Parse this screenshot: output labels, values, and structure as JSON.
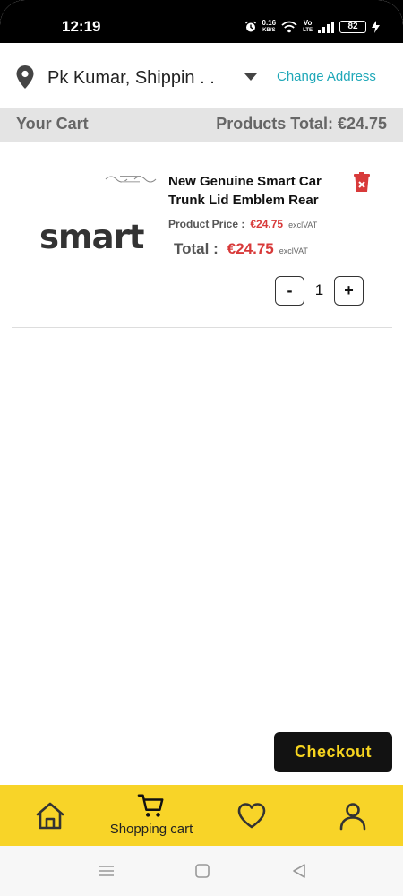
{
  "status_bar": {
    "time": "12:19",
    "net_speed_value": "0.16",
    "net_speed_unit": "KB/S",
    "volte_top": "Vo",
    "volte_bottom": "LTE",
    "battery": "82"
  },
  "address": {
    "text": "Pk Kumar, Shippin . .",
    "change_label": "Change Address"
  },
  "cart_header": {
    "title": "Your Cart",
    "products_total": "Products Total: €24.75"
  },
  "cart_items": [
    {
      "brand": "smart",
      "title": "New Genuine Smart Car Trunk Lid Emblem Rear",
      "price_label": "Product Price :",
      "price": "€24.75",
      "price_vat": "exclVAT",
      "total_label": "Total :",
      "total": "€24.75",
      "total_vat": "exclVAT",
      "quantity": "1",
      "minus_label": "-",
      "plus_label": "+"
    }
  ],
  "checkout_label": "Checkout",
  "bottom_nav": {
    "home_icon": "home-icon",
    "cart_label": "Shopping cart",
    "cart_icon": "cart-icon",
    "wishlist_icon": "heart-icon",
    "profile_icon": "user-icon"
  },
  "colors": {
    "accent_yellow": "#f8d428",
    "price_red": "#d83a3a",
    "link_teal": "#1fa8b8",
    "checkout_bg": "#121212"
  }
}
